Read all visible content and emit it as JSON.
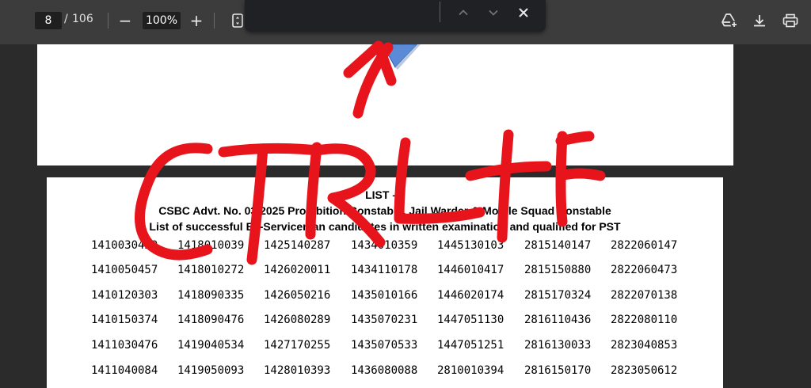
{
  "toolbar": {
    "current_page": "8",
    "separator": "/",
    "total_pages": "106",
    "zoom_out_label": "−",
    "zoom_level": "100%",
    "zoom_in_label": "+",
    "icons": [
      "fit-page-icon",
      "add-to-drive-icon",
      "download-icon",
      "print-icon"
    ]
  },
  "findbar": {
    "query": "",
    "prev_icon": "chevron-up-icon",
    "next_icon": "chevron-down-icon",
    "close_icon": "close-icon"
  },
  "document": {
    "list_heading": "LIST – I",
    "heading_line1": "CSBC Advt. No. 03/2025 Prohibition Constable, Jail Warder & Mobile Squad Constable",
    "heading_line2": "List of successful Ex-Serviceman candidates in written examination and qualified for PST",
    "rows": [
      [
        "1410030429",
        "1418010039",
        "1425140287",
        "1434010359",
        "1445130103",
        "2815140147",
        "2822060147"
      ],
      [
        "1410050457",
        "1418010272",
        "1426020011",
        "1434110178",
        "1446010417",
        "2815150880",
        "2822060473"
      ],
      [
        "1410120303",
        "1418090335",
        "1426050216",
        "1435010166",
        "1446020174",
        "2815170324",
        "2822070138"
      ],
      [
        "1410150374",
        "1418090476",
        "1426080289",
        "1435070231",
        "1447051130",
        "2816110436",
        "2822080110"
      ],
      [
        "1411030476",
        "1419040534",
        "1427170255",
        "1435070533",
        "1447051251",
        "2816130033",
        "2823040853"
      ],
      [
        "1411040084",
        "1419050093",
        "1428010393",
        "1436080088",
        "2810010394",
        "2816150170",
        "2823050612"
      ]
    ]
  },
  "annotation": {
    "text": "CTRL+F",
    "color": "#e8141c"
  }
}
